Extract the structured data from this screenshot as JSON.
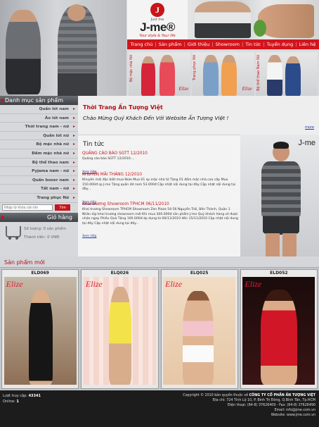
{
  "brand": {
    "logo_letter": "J",
    "tagline": "Just me",
    "name": "J-me®",
    "slogan": "Your style & Your life"
  },
  "nav": [
    "Trang chủ",
    "Sản phẩm",
    "Giới thiệu",
    "Showroom",
    "Tin tức",
    "Tuyển dụng",
    "Liên hệ"
  ],
  "banner": {
    "panels": [
      {
        "vertical": "Bộ mặc nhà Nữ",
        "elize": "Elize"
      },
      {
        "vertical": "Trang phục Nữ",
        "elize": "Elize"
      },
      {
        "vertical": "Bộ thể thao Nam Nữ",
        "elize": ""
      }
    ]
  },
  "sidebar": {
    "title": "Danh mục sản phẩm",
    "categories": [
      "Quần lót nam",
      "Áo lót nam",
      "Thời trang nam - nữ",
      "Quần lót nữ",
      "Bộ mặc nhà nữ",
      "Đầm mặc nhà nữ",
      "Bộ thể thao nam",
      "Pyjama nam - nữ",
      "Quần boxer nam",
      "Tất nam - nữ",
      "Trang phục Nữ"
    ],
    "search_placeholder": "Nhập từ khóa cần tìm",
    "search_button": "Tìm",
    "cart_title": "Giỏ hàng",
    "cart_qty": "Số lượng: 0 sản phẩm",
    "cart_total": "Thành tiền: 0 VNĐ"
  },
  "content": {
    "welcome_title": "Thời Trang Ấn Tượng Việt",
    "welcome_msg": "Chào Mừng Quý Khách Đến Với Website Ấn Tượng Việt !",
    "more": "more",
    "news_title": "Tin tức",
    "news": [
      {
        "title": "QUẢNG CÁO BÁO SGTT 12/2010",
        "body": "Quảng cáo báo SGTT 12/2010....",
        "more": "Xem tiếp"
      },
      {
        "title": "KHUYẾN MÃI THÁNG 12/2010",
        "body": "Khuyến mãi đặc biệt mua Nole Mua 01 sp mặc nhà tử Tặng 01 đầm mặc nhà cao cấp Mua 150.000đ sp J-me Tặng quần lót nam 53.000đ Cập nhật nội dung tại đây Cập nhật nội dung tại đây...",
        "more": "Xem tiếp"
      },
      {
        "title": "Khai trương Showroom TPHCM 06/11/2010",
        "body": "Khai trương Showroom TPHCM Showroom Zen Plaza 54-56 Nguyễn Trãi, Bến Thành, Quận 1 Nhân dịp khai trương showroom mới Khi mua 300.000đ sản phẩm J-me Quý khách hàng sẽ được nhận ngay Phiếu Quà Tặng 100.000đ áp dụng từ 06/11/2010 đến 15/11/2010 Cập nhật nội dung tại đây Cập nhật nội dung tại đây...",
        "more": "Xem tiếp"
      }
    ],
    "promo_brand": "J-me"
  },
  "products": {
    "title": "Sản phẩm mới",
    "items": [
      {
        "code": "ELD069",
        "elize": "Elize"
      },
      {
        "code": "ELQ026",
        "elize": "Elize"
      },
      {
        "code": "ELQ025",
        "elize": "Elize"
      },
      {
        "code": "ELD052",
        "elize": "Elize"
      }
    ]
  },
  "footer": {
    "visits_label": "Lượt truy cập:",
    "visits": "43341",
    "online_label": "Online:",
    "online": "1",
    "copyright_prefix": "Copyright © 2010 bản quyền thuộc về",
    "company": "CÔNG TY CỔ PHẦN ẤN TƯỢNG VIỆT",
    "address": "Địa chỉ: 724 Tỉnh Lộ 10, P. Bình Trị Đông, Q.Bình Tân, Tp.HCM",
    "phone": "Điện thoại: (84-8) 37626409 - Fax: (84-8) 37626490",
    "email_label": "Email:",
    "email": "info@jme.com.vn",
    "website_label": "Website:",
    "website": "www.jme.com.vn"
  },
  "colors": {
    "accent_red": "#c8141b",
    "link_blue": "#1a3fa0",
    "footer_bg": "#1c1c1c"
  }
}
